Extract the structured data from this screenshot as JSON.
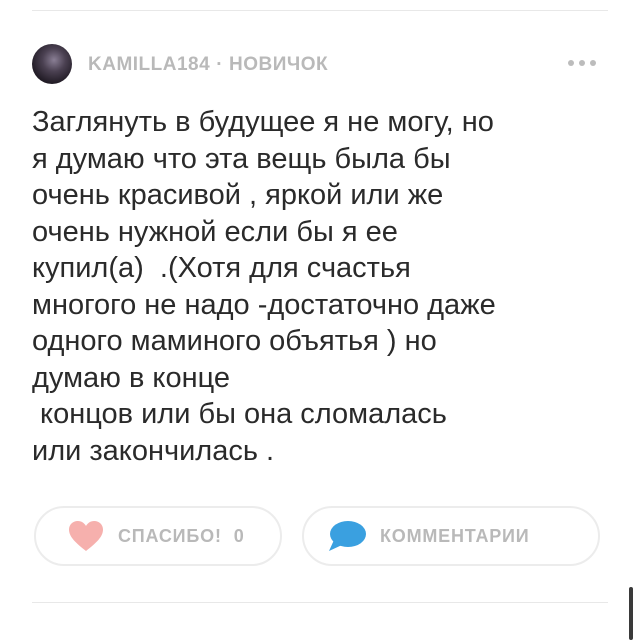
{
  "post": {
    "author": {
      "username": "KAMILLA184",
      "separator": "·",
      "rank": "НОВИЧОК"
    },
    "body_lines": [
      "Заглянуть в будущее я не могу, но",
      "я думаю что эта вещь была бы",
      "очень красивой , яркой или же",
      "очень нужной если бы я ее",
      "купил(а)  .(Хотя для счастья",
      "многого не надо -достаточно даже",
      "одного маминого объятья ) но",
      "думаю в конце",
      " концов или бы она сломалась",
      "или закончилась ."
    ],
    "actions": {
      "thanks_label": "СПАСИБО!",
      "thanks_count": "0",
      "comments_label": "КОММЕНТАРИИ"
    }
  },
  "icons": {
    "more": "more-dots-icon",
    "thanks": "heart-icon",
    "comments": "speech-bubble-icon"
  },
  "colors": {
    "heart": "#f6b0ad",
    "comment_bubble": "#3aa0e0",
    "muted_text": "#b9b9b9",
    "body_text": "#2a2a2a"
  }
}
